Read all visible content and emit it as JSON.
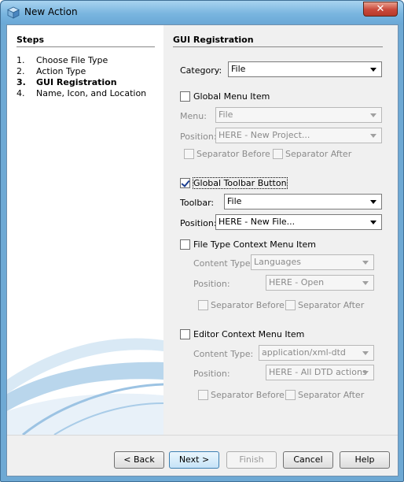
{
  "window": {
    "title": "New Action",
    "close_label": "✕"
  },
  "steps": {
    "title": "Steps",
    "items": [
      {
        "num": "1.",
        "label": "Choose File Type"
      },
      {
        "num": "2.",
        "label": "Action Type"
      },
      {
        "num": "3.",
        "label": "GUI Registration"
      },
      {
        "num": "4.",
        "label": "Name, Icon, and Location"
      }
    ]
  },
  "gui": {
    "title": "GUI Registration",
    "category_label": "Category:",
    "category_value": "File",
    "global_menu": {
      "label": "Global Menu Item",
      "checked": false,
      "menu_label": "Menu:",
      "menu_value": "File",
      "position_label": "Position:",
      "position_value": "HERE - New Project...",
      "sep_before": "Separator Before",
      "sep_after": "Separator After"
    },
    "global_toolbar": {
      "label": "Global Toolbar Button",
      "checked": true,
      "toolbar_label": "Toolbar:",
      "toolbar_value": "File",
      "position_label": "Position:",
      "position_value": "HERE - New File..."
    },
    "file_type_ctx": {
      "label": "File Type Context Menu Item",
      "checked": false,
      "content_type_label": "Content Type:",
      "content_type_value": "Languages",
      "position_label": "Position:",
      "position_value": "HERE - Open",
      "sep_before": "Separator Before",
      "sep_after": "Separator After"
    },
    "editor_ctx": {
      "label": "Editor Context Menu Item",
      "checked": false,
      "content_type_label": "Content Type:",
      "content_type_value": "application/xml-dtd",
      "position_label": "Position:",
      "position_value": "HERE - All DTD actions",
      "sep_before": "Separator Before",
      "sep_after": "Separator After"
    }
  },
  "buttons": {
    "back": "< Back",
    "next": "Next >",
    "finish": "Finish",
    "cancel": "Cancel",
    "help": "Help"
  }
}
